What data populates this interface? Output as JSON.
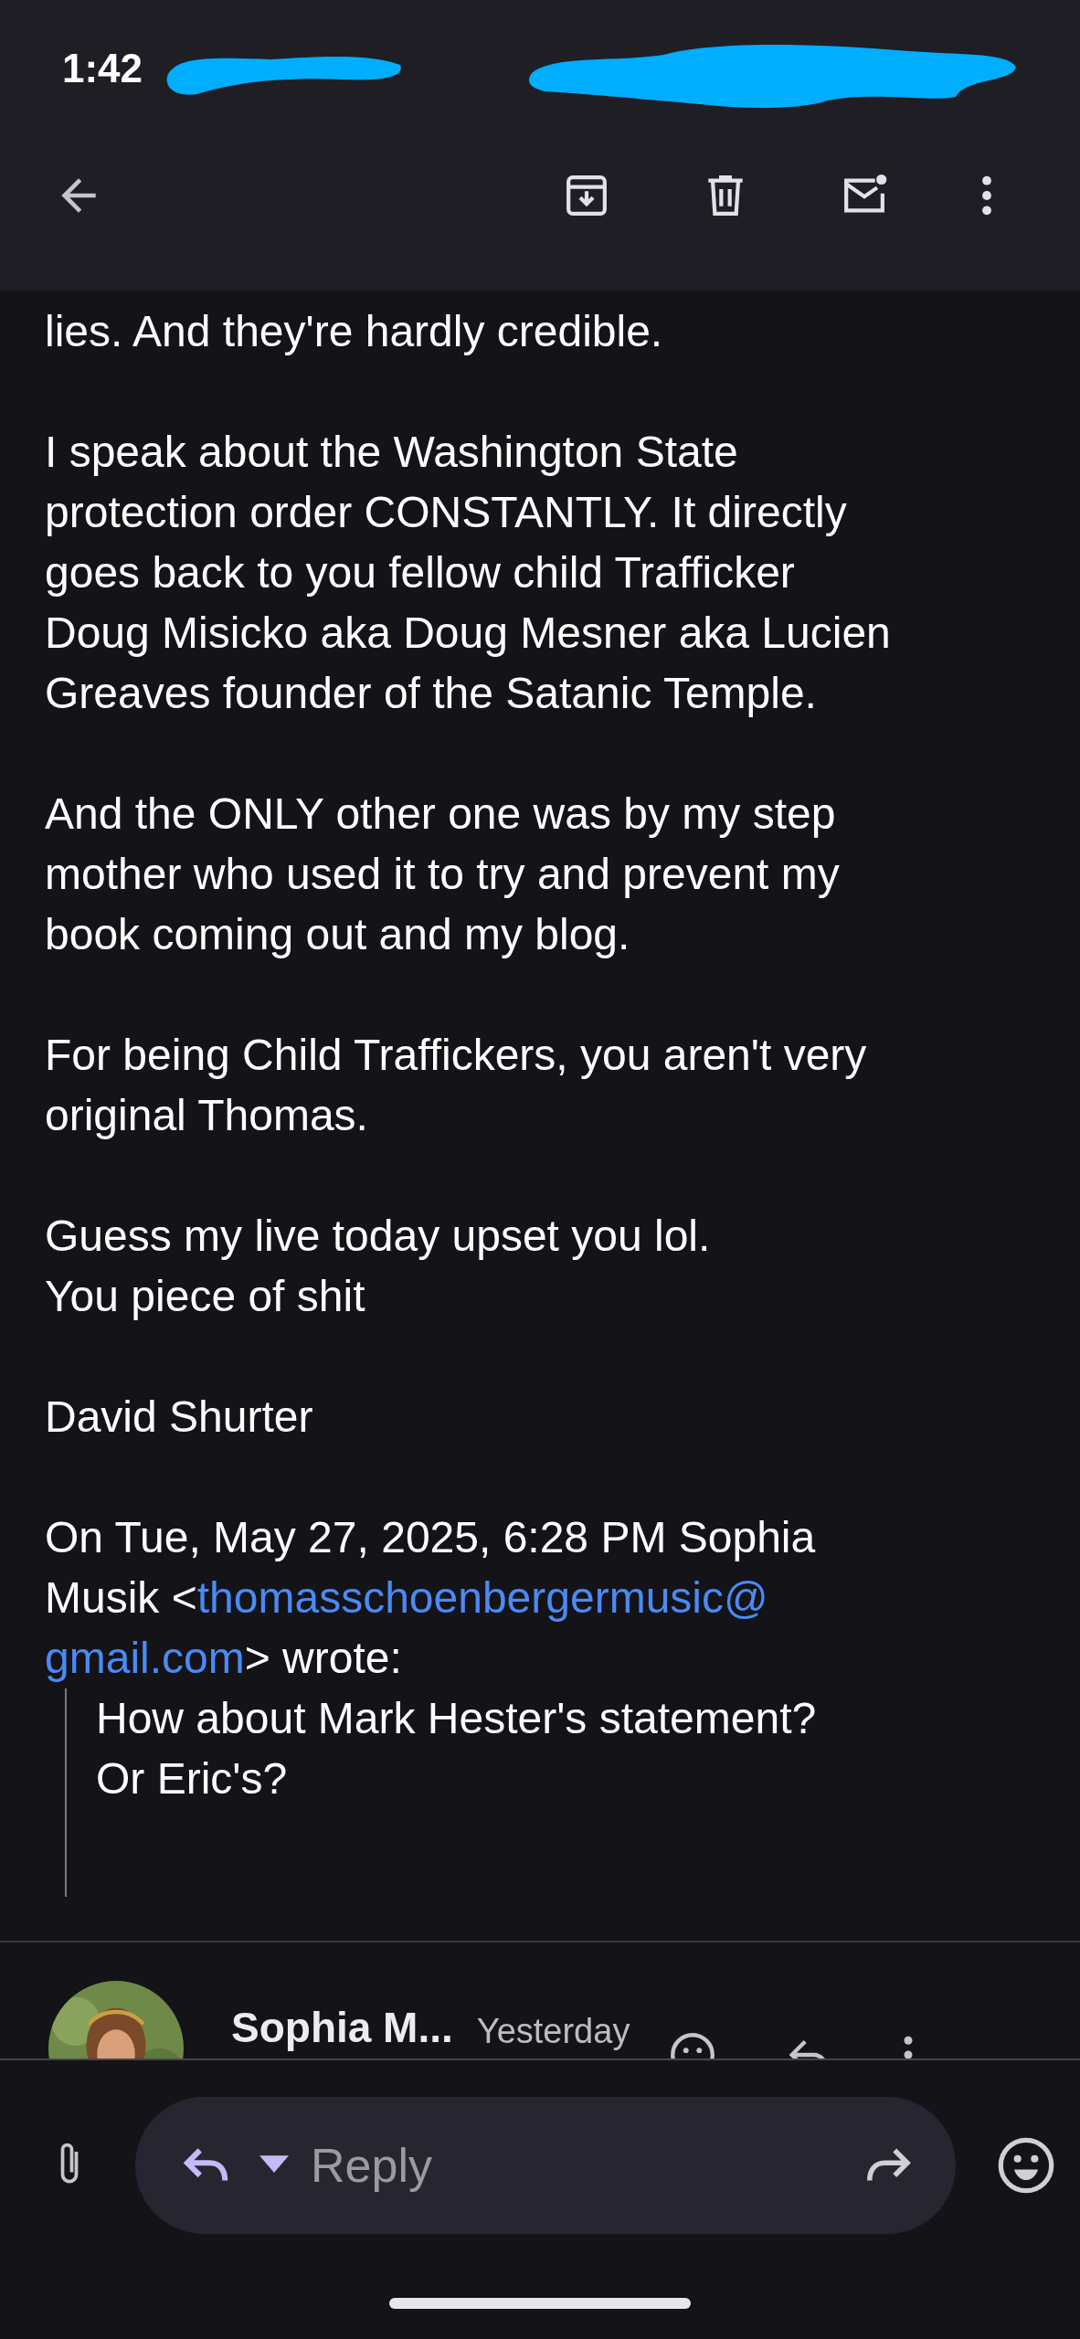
{
  "status_bar": {
    "time": "1:42"
  },
  "message": {
    "paragraphs": [
      {
        "text": "lies. And they're hardly credible."
      },
      {
        "text": "I speak about the Washington State\nprotection order CONSTANTLY. It directly\ngoes back to you fellow child Trafficker\nDoug Misicko aka Doug Mesner aka Lucien\nGreaves founder of the Satanic Temple."
      },
      {
        "text": "And the ONLY other one was by my step\nmother who used it to try and prevent my\nbook coming out and my blog."
      },
      {
        "text": "For being Child Traffickers, you aren't very\noriginal Thomas."
      },
      {
        "text": "Guess my live today upset you lol.\nYou piece of shit"
      },
      {
        "text": "David Shurter"
      }
    ],
    "quote_header": [
      [
        {
          "text": "On Tue, May 27, 2025, 6:28 PM Sophia",
          "kind": "plain"
        }
      ],
      [
        {
          "text": "Musik <",
          "kind": "plain"
        },
        {
          "text": "thomasschoenbergermusic@",
          "kind": "link"
        }
      ],
      [
        {
          "text": "gmail.com",
          "kind": "link"
        },
        {
          "text": "> wrote:",
          "kind": "plain"
        }
      ]
    ],
    "quote": "How about Mark Hester's statement?\nOr Eric's?"
  },
  "next_message": {
    "sender": "Sophia M...",
    "time": "Yesterday"
  },
  "reply_bar": {
    "placeholder": "Reply"
  }
}
